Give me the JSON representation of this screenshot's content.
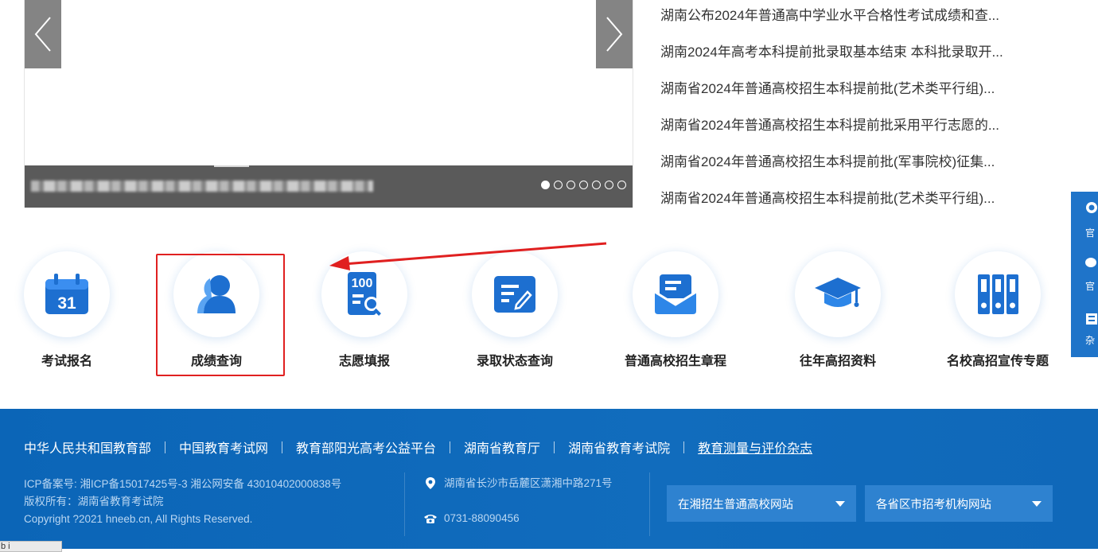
{
  "carousel": {
    "prev_icon": "chevron-left-icon",
    "next_icon": "chevron-right-icon",
    "dot_count": 7,
    "active_index": 0
  },
  "news": [
    "湖南公布2024年普通高中学业水平合格性考试成绩和查...",
    "湖南2024年高考本科提前批录取基本结束 本科批录取开...",
    "湖南省2024年普通高校招生本科提前批(艺术类平行组)...",
    "湖南省2024年普通高校招生本科提前批采用平行志愿的...",
    "湖南省2024年普通高校招生本科提前批(军事院校)征集...",
    "湖南省2024年普通高校招生本科提前批(艺术类平行组)..."
  ],
  "side_float": {
    "items": [
      "官",
      "官",
      "杂"
    ]
  },
  "quick_links": [
    {
      "label": "考试报名",
      "icon": "calendar-icon",
      "day": "31"
    },
    {
      "label": "成绩查询",
      "icon": "user-icon"
    },
    {
      "label": "志愿填报",
      "icon": "score-search-icon",
      "badge": "100"
    },
    {
      "label": "录取状态查询",
      "icon": "edit-form-icon"
    },
    {
      "label": "普通高校招生章程",
      "icon": "inbox-icon"
    },
    {
      "label": "往年高招资料",
      "icon": "graduation-cap-icon"
    },
    {
      "label": "名校高招宣传专题",
      "icon": "binders-icon"
    }
  ],
  "footer": {
    "links": [
      "中华人民共和国教育部",
      "中国教育考试网",
      "教育部阳光高考公益平台",
      "湖南省教育厅",
      "湖南省教育考试院",
      "教育测量与评价杂志"
    ],
    "icp": "ICP备案号: 湘ICP备15017425号-3 湘公网安备 43010402000838号",
    "rights": "版权所有：湖南省教育考试院",
    "copyright": "Copyright ?2021 hneeb.cn, All Rights Reserved.",
    "address": "湖南省长沙市岳麓区潇湘中路271号",
    "phone": "0731-88090456",
    "select1": "在湘招生普通高校网站",
    "select2": "各省区市招考机构网站"
  },
  "tooltip": "b i   "
}
